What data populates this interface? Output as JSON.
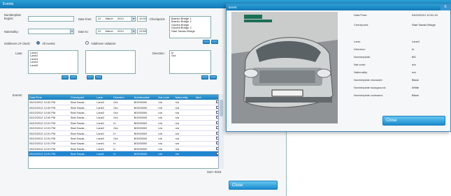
{
  "window": {
    "title": "Events"
  },
  "filters": {
    "numberplate_label": "Numberplate\nbegins:",
    "numberplate_value": "",
    "nationality_label": "Nationality:",
    "nationality_value": "",
    "date_from_label": "Date from:",
    "date_from_day": "22",
    "date_from_month": "March",
    "date_from_year": ", 2012",
    "date_from_time": "10:00",
    "date_to_label": "Date to:",
    "date_to_day": "22",
    "date_to_month": "March",
    "date_to_year": ", 2012",
    "date_to_time": "23:59",
    "checkpoint_label": "Checkpoint:",
    "checkpoints": [
      "Branko Bridge 1",
      "Branko Bridge 2",
      "Gazela Bridge",
      "Gazela Bridge 2",
      "Stari Savski Bridge"
    ],
    "oddeven_label": "Odd/even LP check:",
    "radio_all": "All events",
    "radio_violations": "Odd/even violators",
    "lane_label": "Lane:",
    "lanes": [
      "Lane1",
      "Lane2",
      "Lane3",
      "Lane4",
      "Lane5"
    ],
    "direction_label": "Direction:",
    "directions": [
      "In",
      "Out"
    ]
  },
  "events": {
    "label": "Events:",
    "columns": [
      "Date/Time",
      "Checkpoint",
      "Lane",
      "Direction",
      "Numberplate",
      "Nat code",
      "Nationality",
      "Alert",
      ""
    ],
    "rows": [
      [
        "03/22/2012 12:00 PM",
        "Stari Savsk...",
        "Lane2",
        "Out",
        "BG000000",
        "n/a",
        "n/a",
        "",
        false
      ],
      [
        "03/22/2012 12:00 PM",
        "Stari Savsk...",
        "Lane2",
        "Out",
        "BG000000",
        "n/a",
        "n/a",
        "",
        false
      ],
      [
        "03/22/2012 12:00 PM",
        "Stari Savsk...",
        "Lane2",
        "Out",
        "BG000000",
        "n/a",
        "n/a",
        "",
        false
      ],
      [
        "03/22/2012 12:00 PM",
        "Stari Savsk...",
        "Lane2",
        "Out",
        "BG000000",
        "n/a",
        "n/a",
        "",
        false
      ],
      [
        "03/22/2012 12:01 PM",
        "Stari Savsk...",
        "Lane1",
        "In",
        "BG000000",
        "n/a",
        "n/a",
        "",
        false
      ],
      [
        "03/22/2012 12:01 PM",
        "Stari Savsk...",
        "Lane2",
        "Out",
        "BG000000",
        "n/a",
        "n/a",
        "",
        false
      ],
      [
        "03/22/2012 12:01 PM",
        "Stari Savsk...",
        "Lane1",
        "In",
        "BG000000",
        "n/a",
        "n/a",
        "",
        false
      ],
      [
        "03/22/2012 12:01 PM",
        "Stari Savsk...",
        "Lane2",
        "Out",
        "BG000000",
        "n/a",
        "n/a",
        "",
        false
      ],
      [
        "03/22/2012 12:01 PM",
        "Stari Savsk...",
        "Lane1",
        "In",
        "BG000000",
        "n/a",
        "n/a",
        "",
        false
      ],
      [
        "03/22/2012 12:01 PM",
        "Stari Savsk...",
        "Lane1",
        "In",
        "BG000000",
        "n/a",
        "n/a",
        "",
        false
      ],
      [
        "03/22/2012 12:01 PM",
        "Stari Savsk...",
        "Lane1",
        "In",
        "BG000000",
        "n/a",
        "n/a",
        "",
        true
      ]
    ],
    "selected_row": 10,
    "sum_label": "Sum:",
    "sum_value": "9216"
  },
  "main_close_label": "Close",
  "event_window": {
    "title": "Event",
    "close_x": "X",
    "fields": [
      {
        "label": "Date/Time:",
        "value": "03/22/2012 12:01:15"
      },
      {
        "label": "Checkpoint:",
        "value": "Stari Savski Bridge"
      },
      {
        "label": "Lane:",
        "value": "Lane1"
      },
      {
        "label": "Direction:",
        "value": "In"
      },
      {
        "label": "Numberplate:",
        "value": "BG"
      },
      {
        "label": "Nat code:",
        "value": "n/a"
      },
      {
        "label": "Nationality:",
        "value": "n/a"
      },
      {
        "label": "Numberplate character:",
        "value": "Black"
      },
      {
        "label": "Numberplate background:",
        "value": "White"
      },
      {
        "label": "Numberplate codearea:",
        "value": "Black"
      }
    ],
    "close_label": "Close"
  },
  "colors": {
    "accent": "#1a8ccd",
    "title_bar": "#1f8ac8",
    "selection": "#1f86cf"
  }
}
